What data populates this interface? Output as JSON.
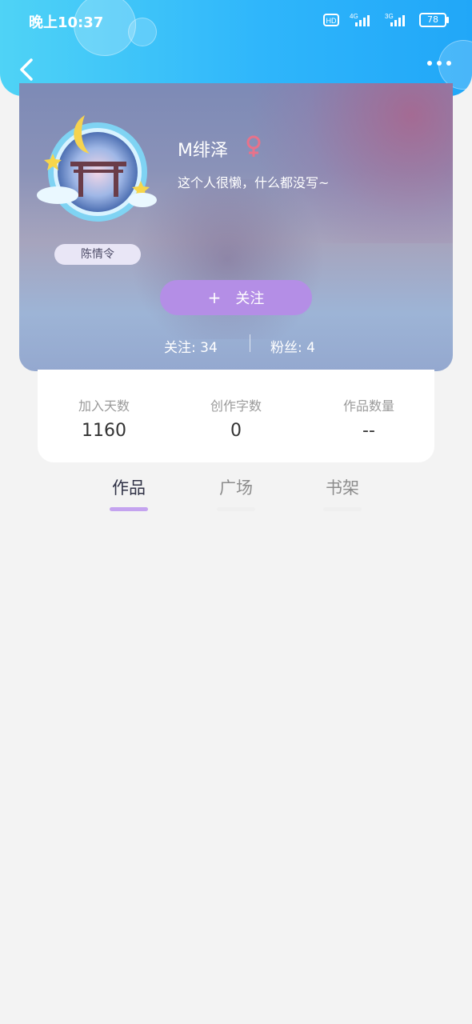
{
  "status_bar": {
    "time": "晚上10:37",
    "battery": "78",
    "network_icons": [
      "hd-icon",
      "4g-signal-icon",
      "3g-signal-icon"
    ]
  },
  "header": {
    "back_icon": "chevron-left-icon",
    "more_icon": "more-horizontal-icon"
  },
  "profile": {
    "username": "M绯泽",
    "gender_icon": "female-icon",
    "bio": "这个人很懒，什么都没写~",
    "avatar_tag": "陈情令",
    "follow_button": "关注",
    "follow_plus": "+",
    "following": "关注: 34",
    "followers": "粉丝: 4"
  },
  "info": {
    "items": [
      {
        "label": "加入天数",
        "value": "1160"
      },
      {
        "label": "创作字数",
        "value": "0"
      },
      {
        "label": "作品数量",
        "value": "--"
      }
    ]
  },
  "tabs": {
    "items": [
      {
        "label": "作品",
        "active": true
      },
      {
        "label": "广场",
        "active": false
      },
      {
        "label": "书架",
        "active": false
      }
    ]
  },
  "colors": {
    "header_gradient": [
      "#4fd3f6",
      "#21a7f8"
    ],
    "follow_button": "#b48ee6",
    "active_tab_underline": "#c4a3ef",
    "gender_icon": "#e8728a"
  }
}
